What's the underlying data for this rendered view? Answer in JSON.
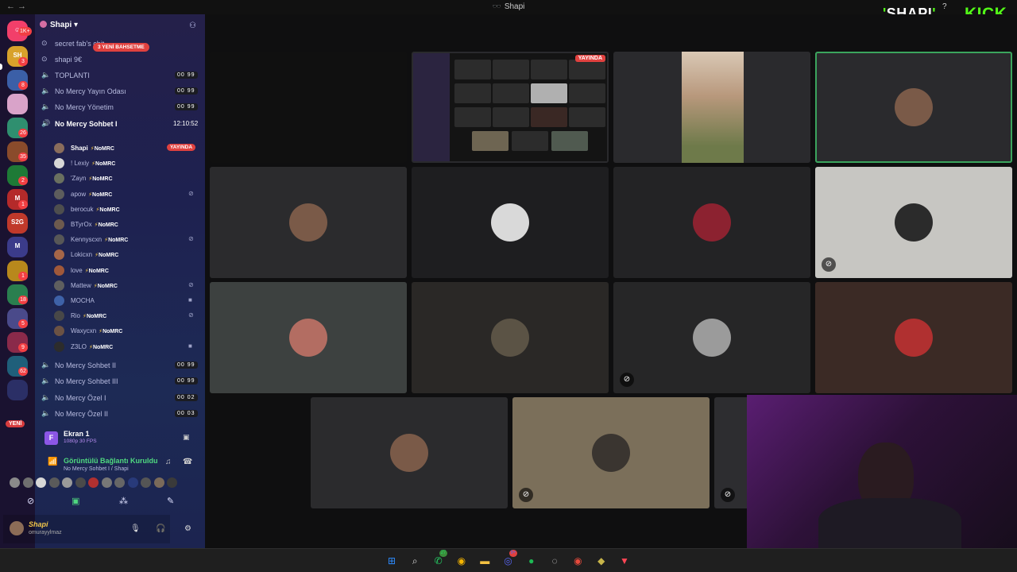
{
  "window": {
    "title": "Shapi",
    "title_emoji": "🕶️"
  },
  "overlay": {
    "brand": "SHAPI",
    "platform": "KICK"
  },
  "rail": {
    "top_badge": "1K+",
    "badges": [
      "3",
      "8",
      "26",
      "35",
      "2",
      "1",
      "1",
      "18",
      "5",
      "9",
      "62"
    ],
    "new_label": "YENİ"
  },
  "guild": {
    "name": "Shapi"
  },
  "mention_pill": "3 YENİ BAHSETME",
  "channels_top": [
    {
      "name": "secret fab's chit",
      "icon": "text"
    },
    {
      "name": "shapi 9€",
      "icon": "text"
    },
    {
      "name": "TOPLANTI",
      "icon": "voice",
      "count": "00 99"
    },
    {
      "name": "No Mercy Yayın Odası",
      "icon": "voice",
      "count": "00 99"
    },
    {
      "name": "No Mercy Yönetim",
      "icon": "voice",
      "count": "00 99"
    }
  ],
  "active_channel": {
    "name": "No Mercy Sohbet I",
    "time": "12:10:52"
  },
  "members": [
    {
      "name": "Shapi",
      "tag": "NoMRC",
      "live": "YAYINDA",
      "color": "#8a6d5c"
    },
    {
      "name": "! Lexiy",
      "tag": "NoMRC",
      "color": "#d7d7d7"
    },
    {
      "name": "'Zayn",
      "tag": "NoMRC",
      "color": "#6a7060"
    },
    {
      "name": "apow",
      "tag": "NoMRC",
      "status": "deaf",
      "color": "#5d5d5d"
    },
    {
      "name": "berocuk",
      "tag": "NoMRC",
      "color": "#4e4e4e"
    },
    {
      "name": "BTyrOx",
      "tag": "NoMRC",
      "color": "#6d5a4e"
    },
    {
      "name": "Kennyscxn",
      "tag": "NoMRC",
      "status": "deaf",
      "color": "#575757"
    },
    {
      "name": "Lokicxn",
      "tag": "NoMRC",
      "color": "#a56648"
    },
    {
      "name": "love",
      "tag": "NoMRC",
      "color": "#a0583a"
    },
    {
      "name": "Mattew",
      "tag": "NoMRC",
      "status": "deaf",
      "color": "#5f5f5f"
    },
    {
      "name": "MOCHA",
      "tag": "",
      "status": "camera",
      "color": "#3e62a8"
    },
    {
      "name": "Rio",
      "tag": "NoMRC",
      "status": "deaf",
      "color": "#484848"
    },
    {
      "name": "Waxycxn",
      "tag": "NoMRC",
      "color": "#6b5244"
    },
    {
      "name": "Z3LO",
      "tag": "NoMRC",
      "status": "camera",
      "color": "#2c2c2c"
    }
  ],
  "channels_bottom": [
    {
      "name": "No Mercy Sohbet II",
      "count": "00 99"
    },
    {
      "name": "No Mercy Sohbet III",
      "count": "00 99"
    },
    {
      "name": "No Mercy Özel I",
      "count": "00 02"
    },
    {
      "name": "No Mercy Özel II",
      "count": "00 03"
    }
  ],
  "screen_share": {
    "title": "Ekran 1",
    "quality": "1080p 30 FPS"
  },
  "voice_panel": {
    "status": "Görüntülü Bağlantı Kuruldu",
    "location": "No Mercy Sohbet I / Shapi"
  },
  "user": {
    "name": "Shapi",
    "handle": "omurayylmaz"
  },
  "tiles": [
    {
      "id": "screen",
      "live": "YAYINDA",
      "bg": "#141414"
    },
    {
      "id": "cam",
      "bg": "#2b2b2d"
    },
    {
      "id": "t3",
      "bg": "#2b2b2d",
      "avatar": "#7a5a48"
    },
    {
      "id": "t4",
      "bg": "#1e1e20",
      "avatar": "#d9d9d9"
    },
    {
      "id": "t5",
      "bg": "#232325",
      "avatar": "#8c2230"
    },
    {
      "id": "t6",
      "bg": "#c7c6c2",
      "avatar": "#2b2b2b",
      "mute": true
    },
    {
      "id": "t7",
      "bg": "#3d4140",
      "avatar": "#b36d62"
    },
    {
      "id": "t8",
      "bg": "#2a2826",
      "avatar": "#5b5345"
    },
    {
      "id": "t9",
      "bg": "#262627",
      "avatar": "#9b9b9b",
      "mute": true
    },
    {
      "id": "t10",
      "bg": "#3b2a25",
      "avatar": "#b03030"
    },
    {
      "id": "t11",
      "bg": "#2b2b2d",
      "avatar": "#7a5a48"
    },
    {
      "id": "t12",
      "bg": "#7b6f5a",
      "avatar": "#3a3530",
      "mute": true
    },
    {
      "id": "t13",
      "bg": "#2d2d30",
      "avatar": "#283a7a",
      "mute": true
    },
    {
      "id": "t14",
      "bg": "#6b6a58"
    }
  ],
  "taskbar": {
    "apps": [
      "windows-start",
      "search",
      "whatsapp",
      "chrome",
      "file-explorer",
      "discord",
      "spotify",
      "obs",
      "chrome-alt",
      "game",
      "valorant"
    ],
    "whatsapp_badge": "27",
    "discord_badge": "9+"
  }
}
